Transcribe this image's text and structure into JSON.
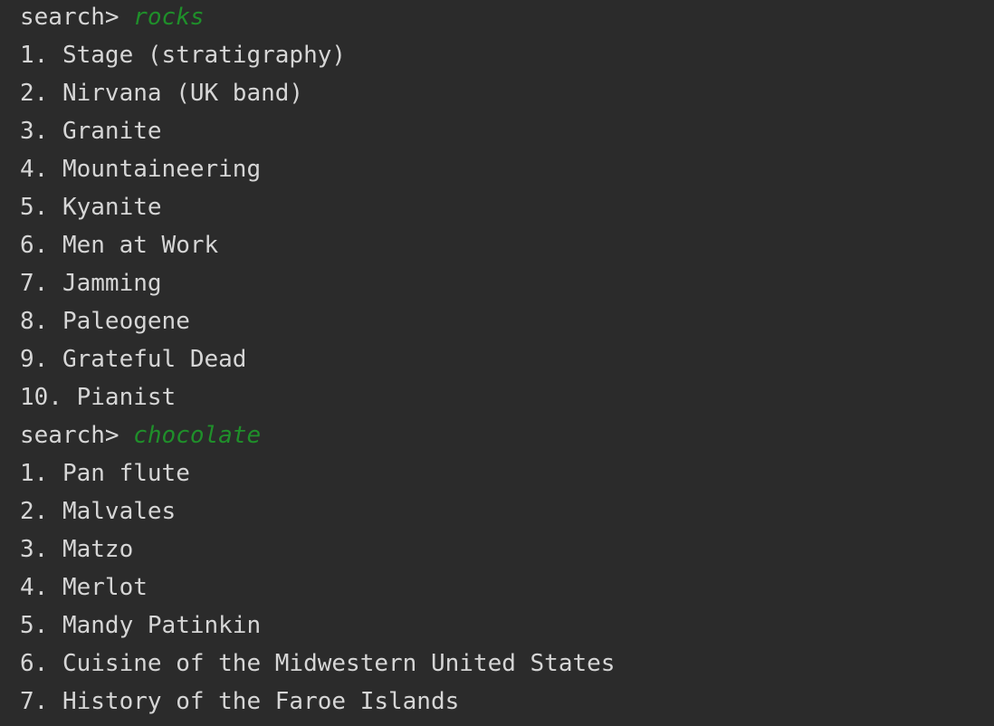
{
  "colors": {
    "background": "#2b2b2b",
    "text": "#d6d6d6",
    "query": "#1f8f2a"
  },
  "sessions": [
    {
      "prompt": "search> ",
      "query": "rocks",
      "results": [
        {
          "num": "1. ",
          "title": "Stage (stratigraphy)"
        },
        {
          "num": "2. ",
          "title": "Nirvana (UK band)"
        },
        {
          "num": "3. ",
          "title": "Granite"
        },
        {
          "num": "4. ",
          "title": "Mountaineering"
        },
        {
          "num": "5. ",
          "title": "Kyanite"
        },
        {
          "num": "6. ",
          "title": "Men at Work"
        },
        {
          "num": "7. ",
          "title": "Jamming"
        },
        {
          "num": "8. ",
          "title": "Paleogene"
        },
        {
          "num": "9. ",
          "title": "Grateful Dead"
        },
        {
          "num": "10. ",
          "title": "Pianist"
        }
      ]
    },
    {
      "prompt": "search> ",
      "query": "chocolate",
      "results": [
        {
          "num": "1. ",
          "title": "Pan flute"
        },
        {
          "num": "2. ",
          "title": "Malvales"
        },
        {
          "num": "3. ",
          "title": "Matzo"
        },
        {
          "num": "4. ",
          "title": "Merlot"
        },
        {
          "num": "5. ",
          "title": "Mandy Patinkin"
        },
        {
          "num": "6. ",
          "title": "Cuisine of the Midwestern United States"
        },
        {
          "num": "7. ",
          "title": "History of the Faroe Islands"
        }
      ]
    }
  ]
}
